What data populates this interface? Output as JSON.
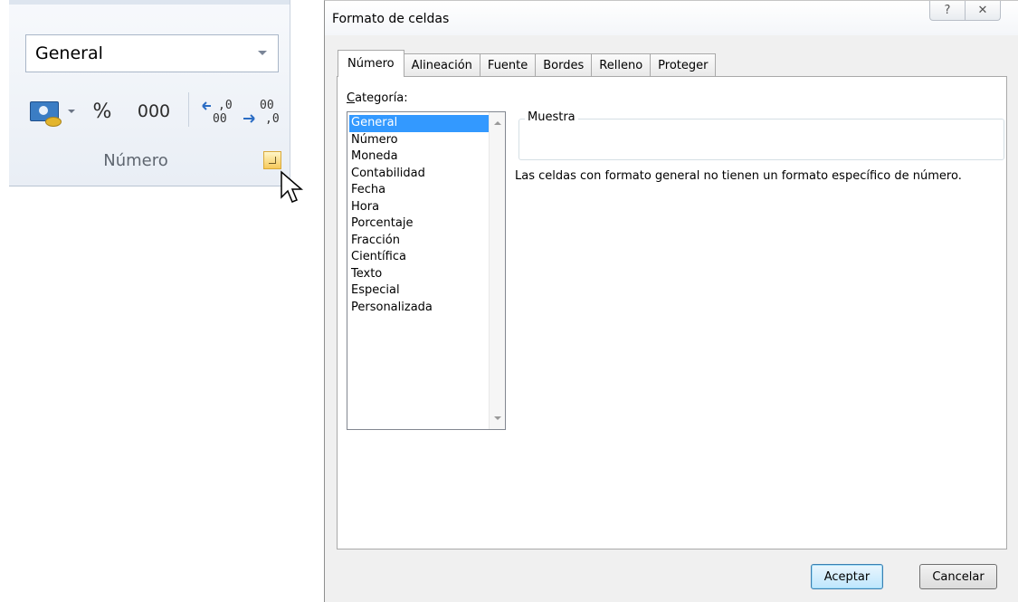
{
  "ribbon": {
    "number_format_value": "General",
    "percent_label": "%",
    "thousands_label": "000",
    "group_label": "Número",
    "icons": [
      "accounting-format-icon",
      "dropdown-arrow-icon",
      "increase-decimal-icon",
      "decrease-decimal-icon",
      "dialog-launcher-icon",
      "mouse-cursor-icon"
    ]
  },
  "dialog": {
    "title": "Formato de celdas",
    "help_glyph": "?",
    "close_glyph": "✕",
    "tabs": [
      {
        "label": "Número",
        "active": true
      },
      {
        "label": "Alineación",
        "active": false
      },
      {
        "label": "Fuente",
        "active": false
      },
      {
        "label": "Bordes",
        "active": false
      },
      {
        "label": "Relleno",
        "active": false
      },
      {
        "label": "Proteger",
        "active": false
      }
    ],
    "category_label_first": "C",
    "category_label_rest": "ategoría:",
    "categories": [
      "General",
      "Número",
      "Moneda",
      "Contabilidad",
      "Fecha",
      "Hora",
      "Porcentaje",
      "Fracción",
      "Científica",
      "Texto",
      "Especial",
      "Personalizada"
    ],
    "selected_category": "General",
    "sample_label": "Muestra",
    "sample_value": "",
    "description": "Las celdas con formato general no tienen un formato específico de número.",
    "ok_label": "Aceptar",
    "cancel_label": "Cancelar"
  },
  "colors": {
    "selection": "#3399ff",
    "launcher": "#f6c95a",
    "dialog_bg": "#f0f0f0"
  }
}
